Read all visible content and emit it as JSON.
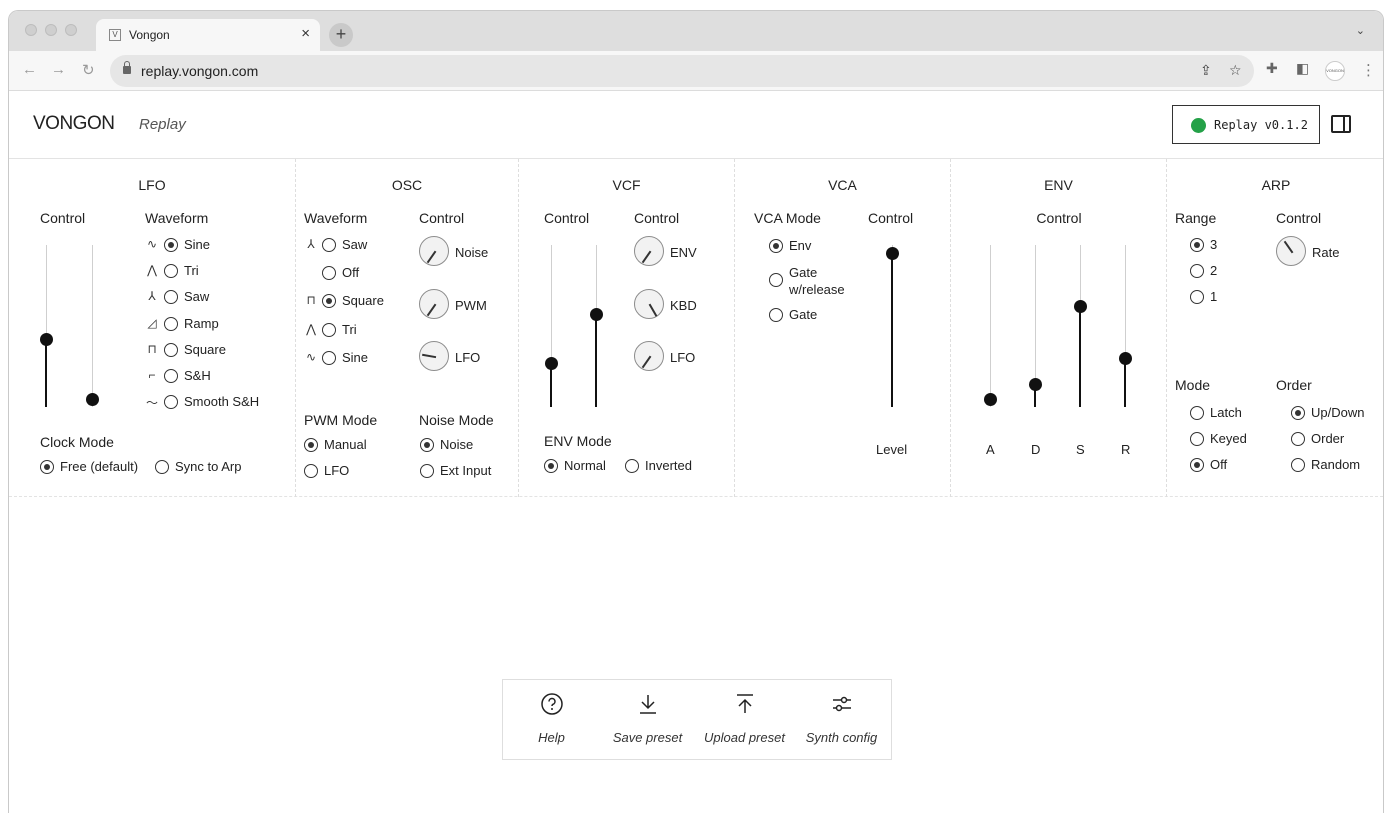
{
  "browser": {
    "tab_title": "Vongon",
    "favicon": "V",
    "url": "replay.vongon.com"
  },
  "app": {
    "logo": "VONGON",
    "subtitle": "Replay",
    "version": "Replay v0.1.2",
    "status_color": "#24a148"
  },
  "lfo": {
    "title": "LFO",
    "control_label": "Control",
    "waveform_label": "Waveform",
    "waveforms": [
      {
        "label": "Sine",
        "icon": "∿",
        "selected": true
      },
      {
        "label": "Tri",
        "icon": "⋀",
        "selected": false
      },
      {
        "label": "Saw",
        "icon": "⅄",
        "selected": false
      },
      {
        "label": "Ramp",
        "icon": "◿",
        "selected": false
      },
      {
        "label": "Square",
        "icon": "⊓",
        "selected": false
      },
      {
        "label": "S&H",
        "icon": "⌐",
        "selected": false
      },
      {
        "label": "Smooth S&H",
        "icon": "〜",
        "selected": false
      }
    ],
    "clock_mode_label": "Clock Mode",
    "clock_modes": [
      {
        "label": "Free (default)",
        "selected": true
      },
      {
        "label": "Sync to Arp",
        "selected": false
      }
    ]
  },
  "osc": {
    "title": "OSC",
    "waveform_label": "Waveform",
    "control_label": "Control",
    "waveforms": [
      {
        "label": "Saw",
        "icon": "⅄",
        "selected": false
      },
      {
        "label": "Off",
        "icon": "",
        "selected": false
      },
      {
        "label": "Square",
        "icon": "⊓",
        "selected": true
      },
      {
        "label": "Tri",
        "icon": "⋀",
        "selected": false
      },
      {
        "label": "Sine",
        "icon": "∿",
        "selected": false
      }
    ],
    "knobs": [
      {
        "label": "Noise"
      },
      {
        "label": "PWM"
      },
      {
        "label": "LFO"
      }
    ],
    "pwm_mode_label": "PWM Mode",
    "pwm_modes": [
      {
        "label": "Manual",
        "selected": true
      },
      {
        "label": "LFO",
        "selected": false
      }
    ],
    "noise_mode_label": "Noise Mode",
    "noise_modes": [
      {
        "label": "Noise",
        "selected": true
      },
      {
        "label": "Ext Input",
        "selected": false
      }
    ]
  },
  "vcf": {
    "title": "VCF",
    "control_label_1": "Control",
    "control_label_2": "Control",
    "knobs": [
      {
        "label": "ENV"
      },
      {
        "label": "KBD"
      },
      {
        "label": "LFO"
      }
    ],
    "env_mode_label": "ENV Mode",
    "env_modes": [
      {
        "label": "Normal",
        "selected": true
      },
      {
        "label": "Inverted",
        "selected": false
      }
    ]
  },
  "vca": {
    "title": "VCA",
    "mode_label": "VCA Mode",
    "control_label": "Control",
    "modes": [
      {
        "label": "Env",
        "selected": true
      },
      {
        "label": "Gate\nw/release",
        "selected": false
      },
      {
        "label": "Gate",
        "selected": false
      }
    ],
    "level_label": "Level"
  },
  "env": {
    "title": "ENV",
    "control_label": "Control",
    "sliders": [
      {
        "label": "A"
      },
      {
        "label": "D"
      },
      {
        "label": "S"
      },
      {
        "label": "R"
      }
    ]
  },
  "arp": {
    "title": "ARP",
    "range_label": "Range",
    "control_label": "Control",
    "ranges": [
      {
        "label": "3",
        "selected": true
      },
      {
        "label": "2",
        "selected": false
      },
      {
        "label": "1",
        "selected": false
      }
    ],
    "knob_label": "Rate",
    "mode_label": "Mode",
    "modes": [
      {
        "label": "Latch",
        "selected": false
      },
      {
        "label": "Keyed",
        "selected": false
      },
      {
        "label": "Off",
        "selected": true
      }
    ],
    "order_label": "Order",
    "orders": [
      {
        "label": "Up/Down",
        "selected": true
      },
      {
        "label": "Order",
        "selected": false
      },
      {
        "label": "Random",
        "selected": false
      }
    ]
  },
  "toolbar": {
    "help": "Help",
    "save": "Save preset",
    "upload": "Upload preset",
    "config": "Synth config"
  }
}
